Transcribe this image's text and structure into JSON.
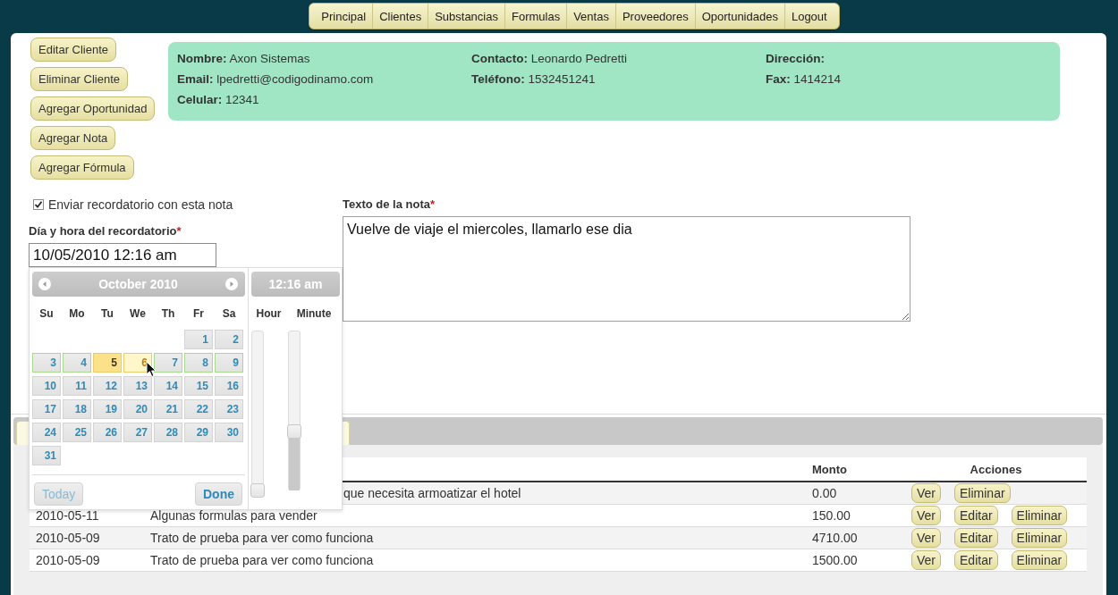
{
  "nav": {
    "items": [
      "Principal",
      "Clientes",
      "Substancias",
      "Formulas",
      "Ventas",
      "Proveedores",
      "Oportunidades",
      "Logout"
    ]
  },
  "actions": [
    "Editar Cliente",
    "Eliminar Cliente",
    "Agregar Oportunidad",
    "Agregar Nota",
    "Agregar Fórmula"
  ],
  "client": {
    "fields": [
      {
        "label": "Nombre:",
        "value": "Axon Sistemas"
      },
      {
        "label": "Contacto:",
        "value": "Leonardo Pedretti"
      },
      {
        "label": "Dirección:"
      },
      {
        "label": "Email:",
        "value": "lpedretti@codigodinamo.com"
      },
      {
        "label": "Teléfono:",
        "value": "1532451241"
      },
      {
        "label": "Fax:",
        "value": "1414214"
      },
      {
        "label": "Celular:",
        "value": "12341"
      }
    ]
  },
  "reminder": {
    "checkbox": {
      "label": "Enviar recordatorio con esta nota",
      "checked": true
    },
    "label": "Día y hora del recordatorio",
    "required_mark": "*",
    "value": "10/05/2010 12:16 am"
  },
  "note": {
    "label": "Texto de la nota",
    "required_mark": "*",
    "value": "Vuelve de viaje el miercoles, llamarlo ese dia"
  },
  "datepicker": {
    "title": "October 2010",
    "weekdays": [
      "Su",
      "Mo",
      "Tu",
      "We",
      "Th",
      "Fr",
      "Sa"
    ],
    "weeks": [
      {
        "highlighted": false,
        "days": [
          {
            "kind": "empty"
          },
          {
            "kind": "empty"
          },
          {
            "kind": "empty"
          },
          {
            "kind": "empty"
          },
          {
            "kind": "empty"
          },
          {
            "kind": "day",
            "label": "1",
            "selected": false,
            "hovered": false
          },
          {
            "kind": "day",
            "label": "2",
            "selected": false,
            "hovered": false
          }
        ]
      },
      {
        "highlighted": true,
        "days": [
          {
            "kind": "day",
            "label": "3",
            "selected": false,
            "hovered": false
          },
          {
            "kind": "day",
            "label": "4",
            "selected": false,
            "hovered": false
          },
          {
            "kind": "day",
            "label": "5",
            "selected": true,
            "hovered": false
          },
          {
            "kind": "day",
            "label": "6",
            "selected": false,
            "hovered": true
          },
          {
            "kind": "day",
            "label": "7",
            "selected": false,
            "hovered": false
          },
          {
            "kind": "day",
            "label": "8",
            "selected": false,
            "hovered": false
          },
          {
            "kind": "day",
            "label": "9",
            "selected": false,
            "hovered": false
          }
        ]
      },
      {
        "highlighted": false,
        "days": [
          {
            "kind": "day",
            "label": "10",
            "selected": false,
            "hovered": false
          },
          {
            "kind": "day",
            "label": "11",
            "selected": false,
            "hovered": false
          },
          {
            "kind": "day",
            "label": "12",
            "selected": false,
            "hovered": false
          },
          {
            "kind": "day",
            "label": "13",
            "selected": false,
            "hovered": false
          },
          {
            "kind": "day",
            "label": "14",
            "selected": false,
            "hovered": false
          },
          {
            "kind": "day",
            "label": "15",
            "selected": false,
            "hovered": false
          },
          {
            "kind": "day",
            "label": "16",
            "selected": false,
            "hovered": false
          }
        ]
      },
      {
        "highlighted": false,
        "days": [
          {
            "kind": "day",
            "label": "17",
            "selected": false,
            "hovered": false
          },
          {
            "kind": "day",
            "label": "18",
            "selected": false,
            "hovered": false
          },
          {
            "kind": "day",
            "label": "19",
            "selected": false,
            "hovered": false
          },
          {
            "kind": "day",
            "label": "20",
            "selected": false,
            "hovered": false
          },
          {
            "kind": "day",
            "label": "21",
            "selected": false,
            "hovered": false
          },
          {
            "kind": "day",
            "label": "22",
            "selected": false,
            "hovered": false
          },
          {
            "kind": "day",
            "label": "23",
            "selected": false,
            "hovered": false
          }
        ]
      },
      {
        "highlighted": false,
        "days": [
          {
            "kind": "day",
            "label": "24",
            "selected": false,
            "hovered": false
          },
          {
            "kind": "day",
            "label": "25",
            "selected": false,
            "hovered": false
          },
          {
            "kind": "day",
            "label": "26",
            "selected": false,
            "hovered": false
          },
          {
            "kind": "day",
            "label": "27",
            "selected": false,
            "hovered": false
          },
          {
            "kind": "day",
            "label": "28",
            "selected": false,
            "hovered": false
          },
          {
            "kind": "day",
            "label": "29",
            "selected": false,
            "hovered": false
          },
          {
            "kind": "day",
            "label": "30",
            "selected": false,
            "hovered": false
          }
        ]
      },
      {
        "highlighted": false,
        "days": [
          {
            "kind": "day",
            "label": "31",
            "selected": false,
            "hovered": false
          }
        ]
      }
    ],
    "buttons": [
      {
        "label": "Today",
        "kind": "secondary"
      },
      {
        "label": "Done",
        "kind": "primary"
      }
    ]
  },
  "timepicker": {
    "title": "12:16 am",
    "sliders": [
      {
        "label": "Hour",
        "level": 0
      },
      {
        "label": "Minute",
        "level": 0.37
      }
    ]
  },
  "table": {
    "headers": [
      "Monto",
      "Acciones"
    ],
    "rows": [
      {
        "kind": "partial",
        "description": "que necesita armoatizar el hotel",
        "amount": "0.00",
        "actions": [
          "Ver",
          "Eliminar"
        ]
      },
      {
        "kind": "full",
        "date": "2010-05-11",
        "description": "Algunas formulas para vender",
        "amount": "150.00",
        "actions": [
          "Ver",
          "Editar",
          "Eliminar"
        ]
      },
      {
        "kind": "full",
        "date": "2010-05-09",
        "description": "Trato de prueba para ver como funciona",
        "amount": "4710.00",
        "actions": [
          "Ver",
          "Editar",
          "Eliminar"
        ]
      },
      {
        "kind": "full",
        "date": "2010-05-09",
        "description": "Trato de prueba para ver como funciona",
        "amount": "1500.00",
        "actions": [
          "Ver",
          "Editar",
          "Eliminar"
        ]
      }
    ]
  }
}
